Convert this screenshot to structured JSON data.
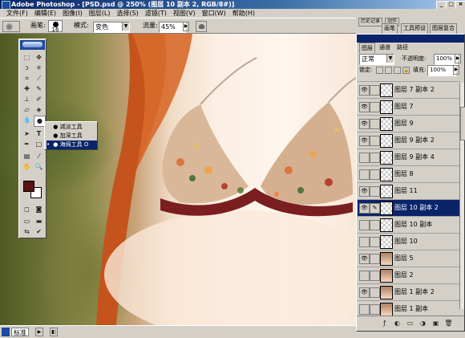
{
  "window": {
    "title": "Adobe Photoshop - [PSD.psd @ 250% (图层 10 副本 2, RGB/8#)]"
  },
  "menu": {
    "items": [
      "文件(F)",
      "编辑(E)",
      "图像(I)",
      "图层(L)",
      "选择(S)",
      "滤镜(T)",
      "视图(V)",
      "窗口(W)",
      "帮助(H)"
    ]
  },
  "options": {
    "brush_label": "画笔:",
    "brush_size": "16",
    "mode_label": "模式:",
    "mode_value": "变色",
    "flow_label": "流量:",
    "flow_value": "45%"
  },
  "dock": {
    "tabs": [
      "画笔",
      "工具预设",
      "图层复合"
    ],
    "tab_small": "历史记录",
    "tab_small2": "动作"
  },
  "toolbox": {
    "flyout_items": [
      "减淡工具",
      "加深工具",
      "海绵工具"
    ],
    "flyout_shortcut": "O",
    "flyout_selected_index": 2,
    "fg_color": "#5a1414",
    "bg_color": "#ffffff"
  },
  "layers_panel": {
    "tabs": [
      "图层",
      "通道",
      "路径"
    ],
    "blend_mode": "正常",
    "opacity_label": "不透明度:",
    "opacity_value": "100%",
    "lock_label": "锁定:",
    "fill_label": "填充:",
    "fill_value": "100%",
    "layers": [
      {
        "name": "图层 7 副本 2",
        "visible": true,
        "thumb": "transparent"
      },
      {
        "name": "图层 7",
        "visible": true,
        "thumb": "transparent"
      },
      {
        "name": "图层 9",
        "visible": true,
        "thumb": "transparent"
      },
      {
        "name": "图层 9 副本 2",
        "visible": true,
        "thumb": "transparent"
      },
      {
        "name": "图层 9 副本 4",
        "visible": false,
        "thumb": "transparent"
      },
      {
        "name": "图层 8",
        "visible": false,
        "thumb": "transparent"
      },
      {
        "name": "图层 11",
        "visible": true,
        "thumb": "transparent"
      },
      {
        "name": "图层 10 副本 2",
        "visible": true,
        "thumb": "transparent",
        "selected": true
      },
      {
        "name": "图层 10 副本",
        "visible": false,
        "thumb": "transparent"
      },
      {
        "name": "图层 10",
        "visible": false,
        "thumb": "transparent"
      },
      {
        "name": "图层 5",
        "visible": true,
        "thumb": "image"
      },
      {
        "name": "图层 2",
        "visible": false,
        "thumb": "image"
      },
      {
        "name": "图层 1 副本 2",
        "visible": true,
        "thumb": "image"
      },
      {
        "name": "图层 1 副本",
        "visible": false,
        "thumb": "image"
      }
    ]
  },
  "status": {
    "zoom_label": "标准"
  }
}
